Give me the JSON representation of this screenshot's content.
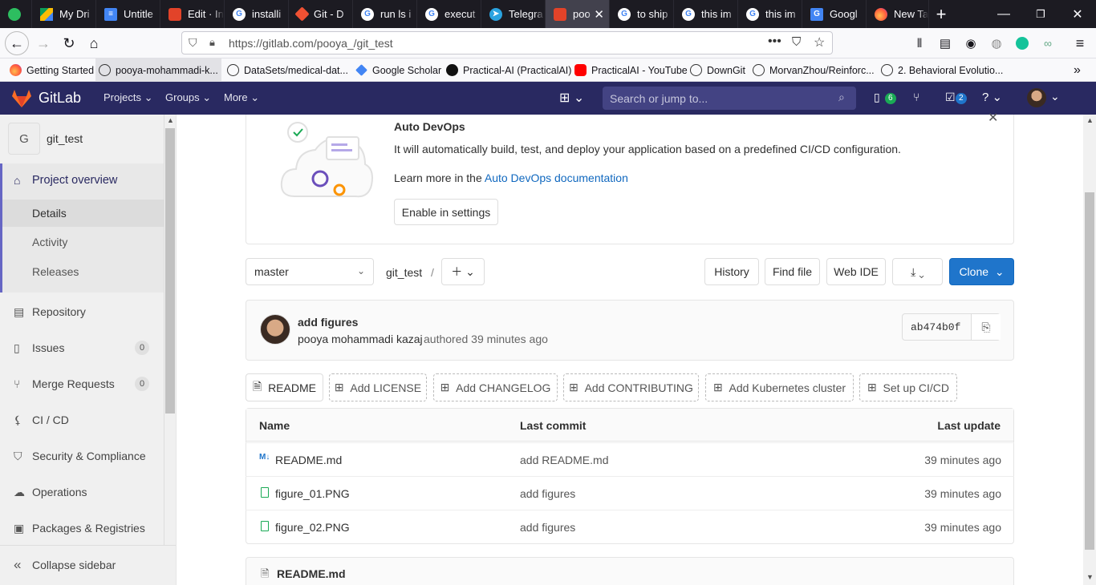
{
  "browser": {
    "tabs": [
      {
        "label": "",
        "icon": "evernote-icon"
      },
      {
        "label": "My Dri",
        "icon": "drive-icon"
      },
      {
        "label": "Untitle",
        "icon": "docs-icon"
      },
      {
        "label": "Edit · In",
        "icon": "gitlab-icon"
      },
      {
        "label": "installi",
        "icon": "google-icon"
      },
      {
        "label": "Git - D",
        "icon": "git-icon"
      },
      {
        "label": "run ls i",
        "icon": "google-icon"
      },
      {
        "label": "execut",
        "icon": "google-icon"
      },
      {
        "label": "Telegra",
        "icon": "telegram-icon"
      },
      {
        "label": "poo",
        "icon": "gitlab-icon"
      },
      {
        "label": "to ship",
        "icon": "google-icon"
      },
      {
        "label": "this im",
        "icon": "google-icon"
      },
      {
        "label": "this im",
        "icon": "google-icon"
      },
      {
        "label": "Googl",
        "icon": "translate-icon"
      },
      {
        "label": "New Ta",
        "icon": "firefox-icon"
      }
    ],
    "url": "https://gitlab.com/pooya_/git_test",
    "bookmarks": [
      "Getting Started",
      "pooya-mohammadi-k...",
      "DataSets/medical-dat...",
      "Google Scholar",
      "Practical-AI (PracticalAI)",
      "PracticalAI - YouTube",
      "DownGit",
      "MorvanZhou/Reinforc...",
      "2. Behavioral Evolutio..."
    ]
  },
  "gitlab": {
    "brand": "GitLab",
    "menus": [
      "Projects",
      "Groups",
      "More"
    ],
    "search_placeholder": "Search or jump to...",
    "issues_count": "6",
    "todos_count": "2"
  },
  "sidebar": {
    "project_initial": "G",
    "project_name": "git_test",
    "overview": "Project overview",
    "sub": [
      "Details",
      "Activity",
      "Releases"
    ],
    "items": [
      {
        "label": "Repository",
        "icon": "book-icon"
      },
      {
        "label": "Issues",
        "icon": "issues-icon",
        "count": "0"
      },
      {
        "label": "Merge Requests",
        "icon": "merge-icon",
        "count": "0"
      },
      {
        "label": "CI / CD",
        "icon": "rocket-icon"
      },
      {
        "label": "Security & Compliance",
        "icon": "shield-icon"
      },
      {
        "label": "Operations",
        "icon": "cloud-icon"
      },
      {
        "label": "Packages & Registries",
        "icon": "package-icon"
      }
    ],
    "collapse": "Collapse sidebar"
  },
  "autodevops": {
    "title": "Auto DevOps",
    "text": "It will automatically build, test, and deploy your application based on a predefined CI/CD configuration.",
    "learn_prefix": "Learn more in the ",
    "learn_link": "Auto DevOps documentation",
    "button": "Enable in settings"
  },
  "toolbar": {
    "branch": "master",
    "path": "git_test",
    "sep": "/",
    "history": "History",
    "find_file": "Find file",
    "web_ide": "Web IDE",
    "clone": "Clone"
  },
  "commit": {
    "message": "add figures",
    "author": "pooya mohammadi kazaj",
    "meta": "authored 39 minutes ago",
    "sha": "ab474b0f"
  },
  "actions": [
    "README",
    "Add LICENSE",
    "Add CHANGELOG",
    "Add CONTRIBUTING",
    "Add Kubernetes cluster",
    "Set up CI/CD"
  ],
  "files": {
    "headers": [
      "Name",
      "Last commit",
      "Last update"
    ],
    "rows": [
      {
        "name": "README.md",
        "commit": "add README.md",
        "updated": "39 minutes ago",
        "icon": "markdown-icon"
      },
      {
        "name": "figure_01.PNG",
        "commit": "add figures",
        "updated": "39 minutes ago",
        "icon": "image-file-icon"
      },
      {
        "name": "figure_02.PNG",
        "commit": "add figures",
        "updated": "39 minutes ago",
        "icon": "image-file-icon"
      }
    ]
  },
  "readme_title": "README.md",
  "colors": {
    "gitlab_header": "#292961",
    "primary": "#1f75cb",
    "link": "#1068bf"
  }
}
